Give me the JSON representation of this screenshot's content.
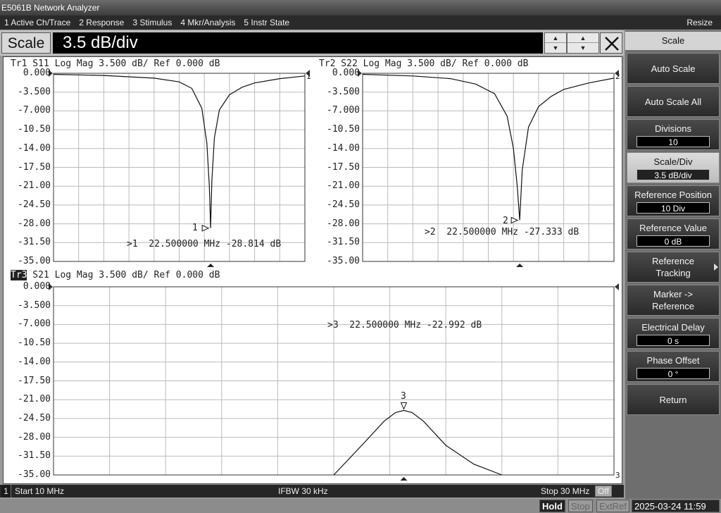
{
  "window": {
    "title": "E5061B Network Analyzer"
  },
  "menu": {
    "items": [
      "1 Active Ch/Trace",
      "2 Response",
      "3 Stimulus",
      "4 Mkr/Analysis",
      "5 Instr State"
    ],
    "resize": "Resize"
  },
  "entry": {
    "label": "Scale",
    "value": "3.5 dB/div"
  },
  "traces": [
    {
      "id": "Tr1",
      "header": "Tr1 S11 Log Mag 3.500 dB/ Ref 0.000 dB",
      "marker_label": "1",
      "marker_readout": ">1  22.500000 MHz -28.814 dB",
      "right_tag": "1"
    },
    {
      "id": "Tr2",
      "header": "Tr2 S22 Log Mag 3.500 dB/ Ref 0.000 dB",
      "marker_label": "2",
      "marker_readout": ">2  22.500000 MHz -27.333 dB",
      "right_tag": "2"
    },
    {
      "id": "Tr3",
      "header_id": "Tr3",
      "header_rest": " S21 Log Mag 3.500 dB/ Ref 0.000 dB",
      "marker_label": "3",
      "marker_readout": ">3  22.500000 MHz -22.992 dB",
      "right_tag": "3"
    }
  ],
  "y_ticks": [
    "0.000",
    "-3.500",
    "-7.000",
    "-10.50",
    "-14.00",
    "-17.50",
    "-21.00",
    "-24.50",
    "-28.00",
    "-31.50",
    "-35.00"
  ],
  "chart_data": [
    {
      "type": "line",
      "title": "Tr1 S11 Log Mag 3.500 dB/ Ref 0.000 dB",
      "ylim": [
        -35,
        0
      ],
      "xlim": [
        10,
        30
      ],
      "x_unit": "MHz",
      "y_unit": "dB",
      "series": [
        {
          "name": "S11",
          "x": [
            10,
            14,
            18,
            20,
            21,
            21.8,
            22.2,
            22.4,
            22.5,
            22.6,
            22.8,
            23.2,
            24,
            25,
            26,
            28,
            30
          ],
          "y": [
            -0.2,
            -0.4,
            -0.9,
            -1.6,
            -2.8,
            -6.5,
            -13,
            -21,
            -28.8,
            -20,
            -12,
            -6.8,
            -4,
            -2.6,
            -1.8,
            -1,
            -0.5
          ]
        }
      ],
      "marker": {
        "x": 22.5,
        "y": -28.814
      }
    },
    {
      "type": "line",
      "title": "Tr2 S22 Log Mag 3.500 dB/ Ref 0.000 dB",
      "ylim": [
        -35,
        0
      ],
      "xlim": [
        10,
        30
      ],
      "x_unit": "MHz",
      "y_unit": "dB",
      "series": [
        {
          "name": "S22",
          "x": [
            10,
            14,
            17,
            19,
            20.5,
            21.5,
            22,
            22.3,
            22.5,
            22.7,
            23.2,
            24,
            25,
            26,
            28,
            30
          ],
          "y": [
            -0.2,
            -0.5,
            -1,
            -2,
            -3.8,
            -8,
            -14,
            -21,
            -27.3,
            -18,
            -10,
            -6.2,
            -4.3,
            -3,
            -1.8,
            -0.9
          ]
        }
      ],
      "marker": {
        "x": 22.5,
        "y": -27.333
      }
    },
    {
      "type": "line",
      "title": "Tr3 S21 Log Mag 3.500 dB/ Ref 0.000 dB",
      "ylim": [
        -35,
        0
      ],
      "xlim": [
        10,
        30
      ],
      "x_unit": "MHz",
      "y_unit": "dB",
      "series": [
        {
          "name": "S21",
          "x": [
            20,
            21,
            21.8,
            22.2,
            22.5,
            22.8,
            23.2,
            24,
            25,
            26
          ],
          "y": [
            -35,
            -29.5,
            -25,
            -23.4,
            -22.99,
            -23.4,
            -25,
            -29.5,
            -33,
            -35
          ]
        }
      ],
      "marker": {
        "x": 22.5,
        "y": -22.992
      }
    }
  ],
  "status": {
    "channel": "1",
    "start": "Start 10 MHz",
    "ifbw": "IFBW 30 kHz",
    "stop": "Stop 30 MHz",
    "off": "Off"
  },
  "bottom": {
    "hold": "Hold",
    "stop": "Stop",
    "extref": "ExtRef",
    "datetime": "2025-03-24 11:59"
  },
  "softkeys": {
    "title": "Scale",
    "auto_scale": "Auto Scale",
    "auto_scale_all": "Auto Scale All",
    "divisions": {
      "label": "Divisions",
      "value": "10"
    },
    "scale_div": {
      "label": "Scale/Div",
      "value": "3.5 dB/div"
    },
    "ref_pos": {
      "label": "Reference Position",
      "value": "10 Div"
    },
    "ref_val": {
      "label": "Reference Value",
      "value": "0 dB"
    },
    "ref_track": {
      "label1": "Reference",
      "label2": "Tracking"
    },
    "marker_ref": {
      "label1": "Marker ->",
      "label2": "Reference"
    },
    "elec_delay": {
      "label": "Electrical Delay",
      "value": "0 s"
    },
    "phase_offset": {
      "label": "Phase Offset",
      "value": "0 °"
    },
    "return": "Return"
  }
}
